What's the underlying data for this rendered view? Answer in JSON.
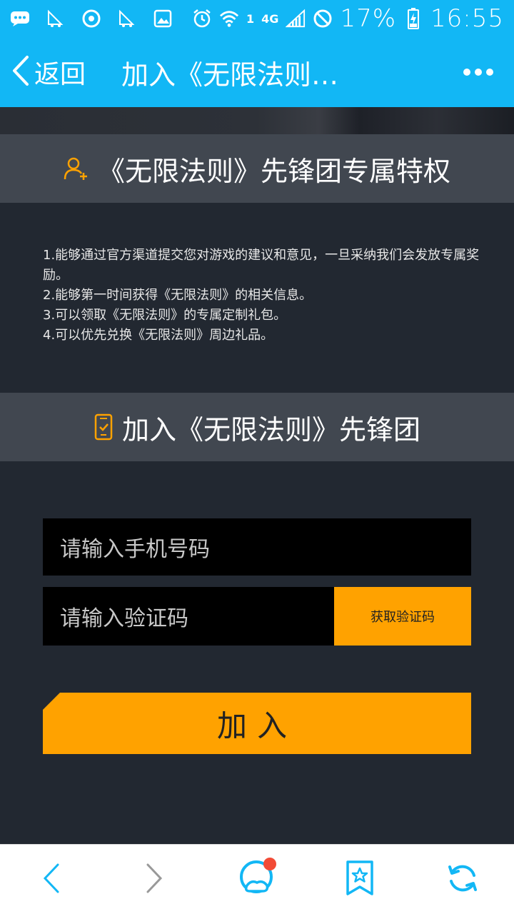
{
  "status_bar": {
    "sim_slot": "1",
    "network": "4G",
    "battery": "17%",
    "time": "16:55"
  },
  "title_bar": {
    "back_label": "返回",
    "title": "加入《无限法则…"
  },
  "section_privileges": {
    "header": "《无限法则》先锋团专属特权",
    "items": [
      "1.能够通过官方渠道提交您对游戏的建议和意见，一旦采纳我们会发放专属奖励。",
      "2.能够第一时间获得《无限法则》的相关信息。",
      "3.可以领取《无限法则》的专属定制礼包。",
      "4.可以优先兑换《无限法则》周边礼品。"
    ]
  },
  "section_join": {
    "header": "加入《无限法则》先锋团",
    "phone_placeholder": "请输入手机号码",
    "code_placeholder": "请输入验证码",
    "get_code_label": "获取验证码",
    "join_label": "加入"
  },
  "colors": {
    "accent_blue": "#12b7f5",
    "accent_orange": "#ffa200",
    "background": "#222831",
    "header_gray": "#414750"
  }
}
